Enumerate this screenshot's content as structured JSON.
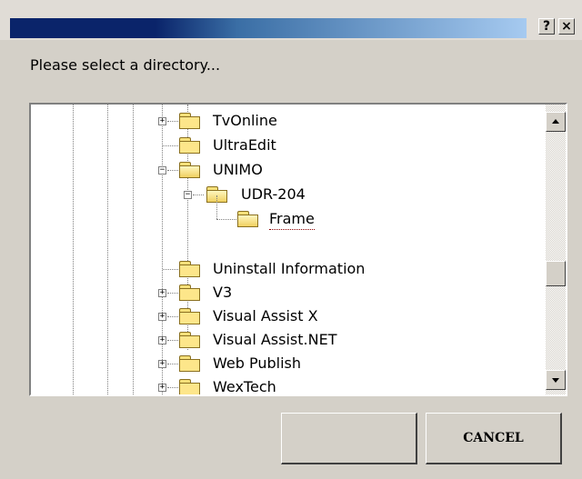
{
  "titlebar": {
    "help_label": "?",
    "close_label": "×"
  },
  "prompt": "Please select a directory...",
  "tree": {
    "items": [
      {
        "label": "TvOnline",
        "expander": "+"
      },
      {
        "label": "UltraEdit",
        "expander": ""
      },
      {
        "label": "UNIMO",
        "expander": "−"
      },
      {
        "label": "UDR-204",
        "expander": "−"
      },
      {
        "label": "Frame",
        "expander": "",
        "selected": true
      },
      {
        "label": "Uninstall Information",
        "expander": ""
      },
      {
        "label": "V3",
        "expander": "+"
      },
      {
        "label": "Visual Assist X",
        "expander": "+"
      },
      {
        "label": "Visual Assist.NET",
        "expander": "+"
      },
      {
        "label": "Web Publish",
        "expander": "+"
      },
      {
        "label": "WexTech",
        "expander": "+"
      }
    ]
  },
  "scrollbar": {
    "position_fraction": 0.6
  },
  "buttons": {
    "ok_label": "",
    "cancel_label": "CANCEL"
  }
}
